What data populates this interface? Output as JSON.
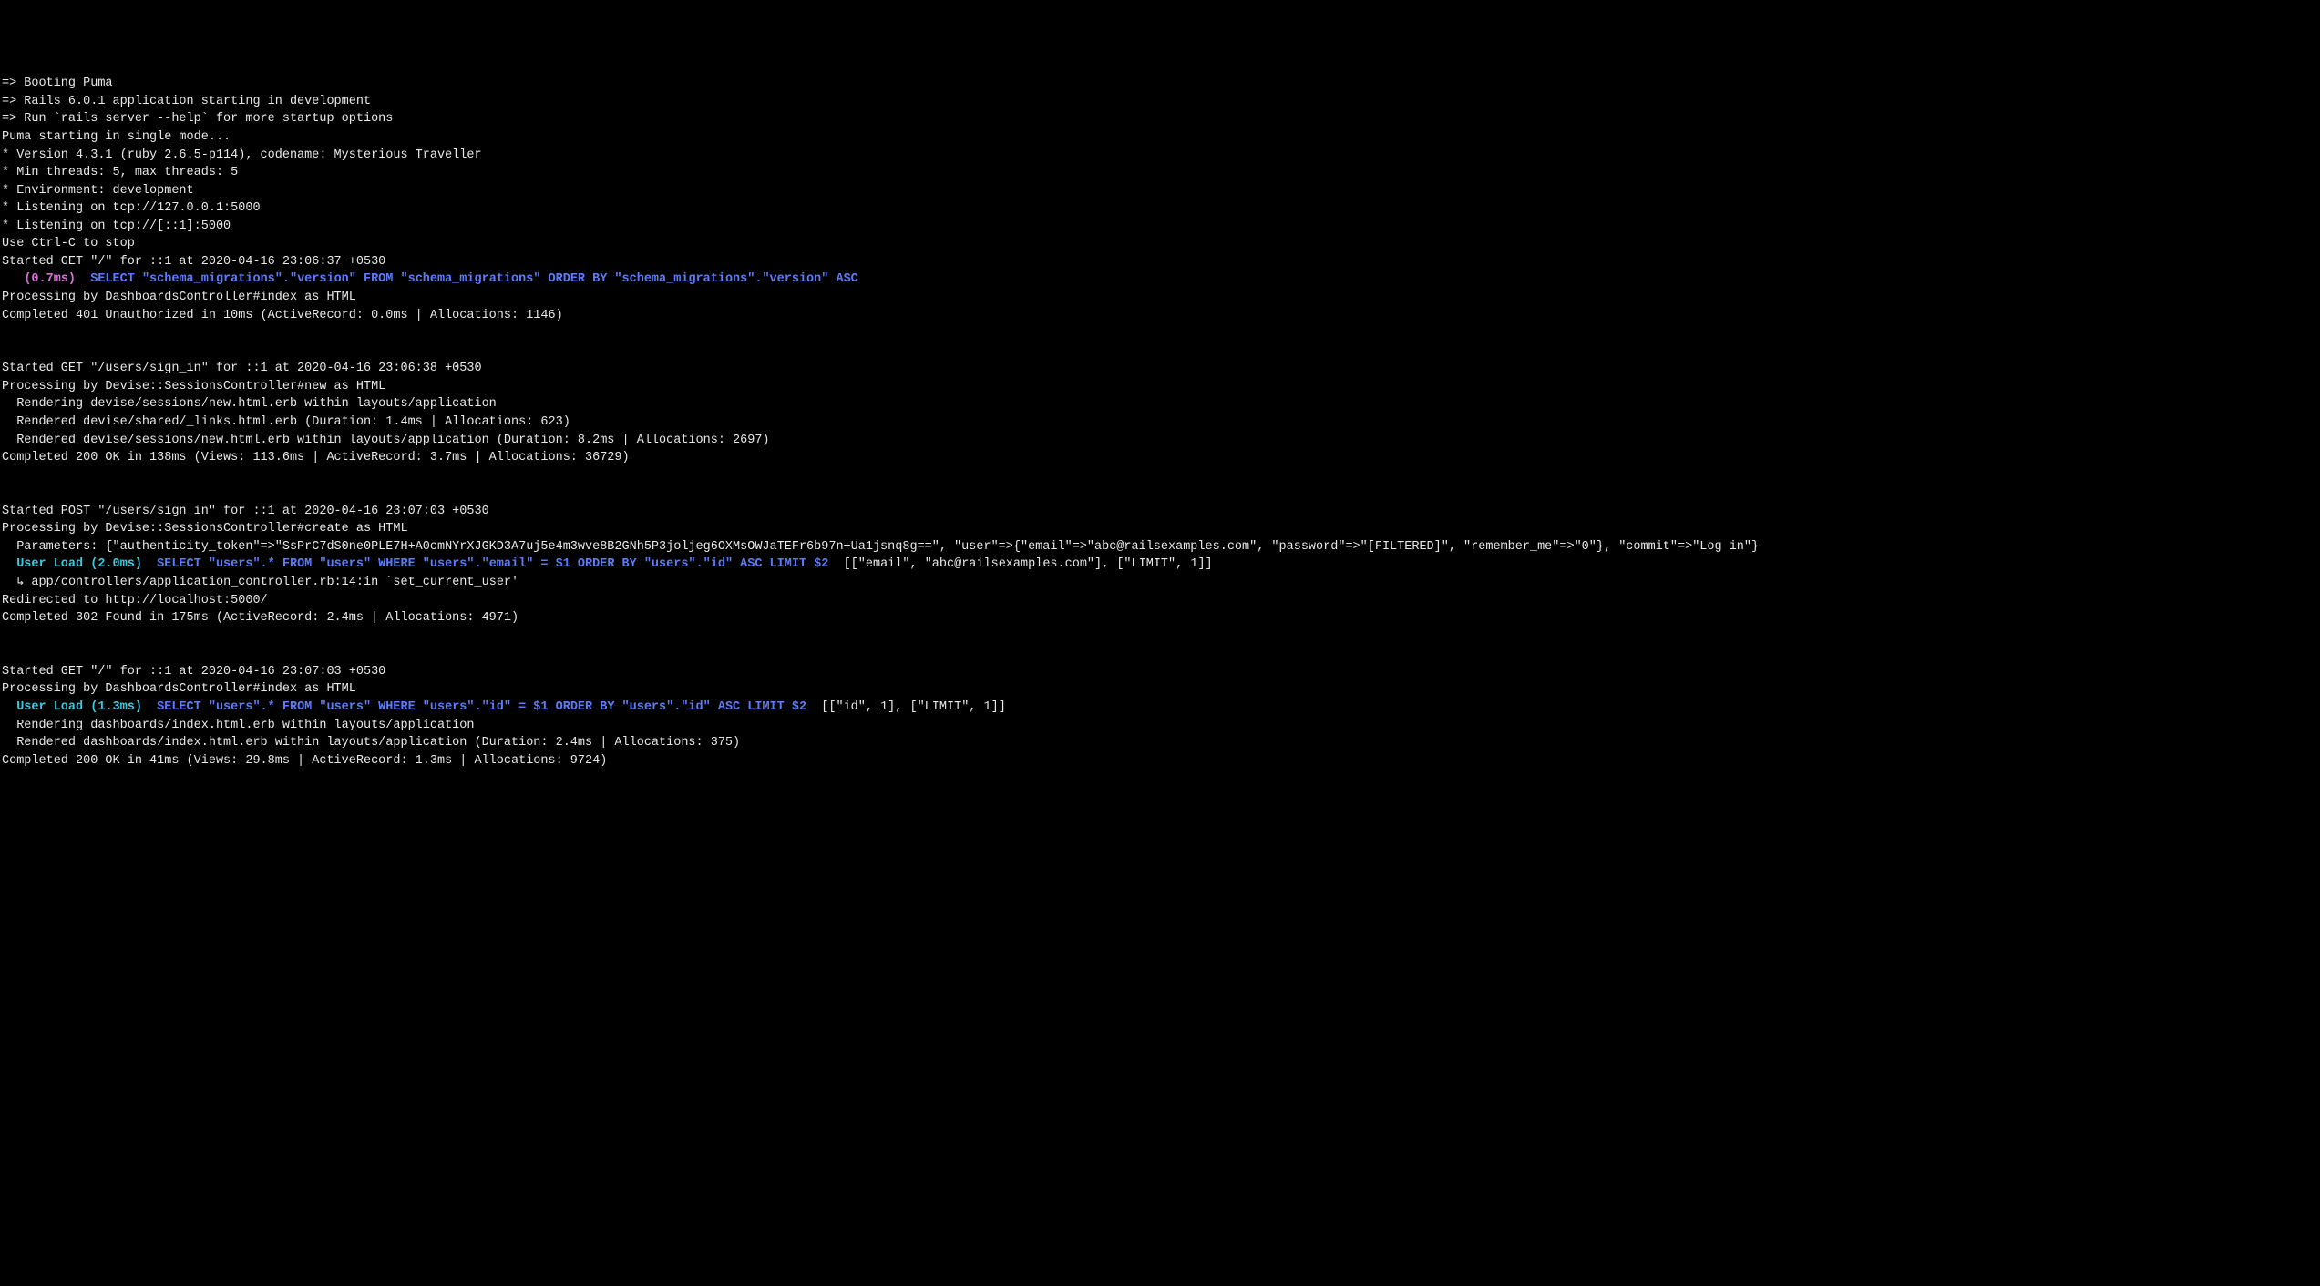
{
  "lines": [
    {
      "segments": [
        {
          "cls": "white",
          "text": "=> Booting Puma"
        }
      ]
    },
    {
      "segments": [
        {
          "cls": "white",
          "text": "=> Rails 6.0.1 application starting in development"
        }
      ]
    },
    {
      "segments": [
        {
          "cls": "white",
          "text": "=> Run `rails server --help` for more startup options"
        }
      ]
    },
    {
      "segments": [
        {
          "cls": "white",
          "text": "Puma starting in single mode..."
        }
      ]
    },
    {
      "segments": [
        {
          "cls": "white",
          "text": "* Version 4.3.1 (ruby 2.6.5-p114), codename: Mysterious Traveller"
        }
      ]
    },
    {
      "segments": [
        {
          "cls": "white",
          "text": "* Min threads: 5, max threads: 5"
        }
      ]
    },
    {
      "segments": [
        {
          "cls": "white",
          "text": "* Environment: development"
        }
      ]
    },
    {
      "segments": [
        {
          "cls": "white",
          "text": "* Listening on tcp://127.0.0.1:5000"
        }
      ]
    },
    {
      "segments": [
        {
          "cls": "white",
          "text": "* Listening on tcp://[::1]:5000"
        }
      ]
    },
    {
      "segments": [
        {
          "cls": "white",
          "text": "Use Ctrl-C to stop"
        }
      ]
    },
    {
      "segments": [
        {
          "cls": "white",
          "text": "Started GET \"/\" for ::1 at 2020-04-16 23:06:37 +0530"
        }
      ]
    },
    {
      "segments": [
        {
          "cls": "white",
          "text": "   "
        },
        {
          "cls": "magenta bold",
          "text": "(0.7ms)"
        },
        {
          "cls": "white",
          "text": "  "
        },
        {
          "cls": "blue bold",
          "text": "SELECT \"schema_migrations\".\"version\" FROM \"schema_migrations\" ORDER BY \"schema_migrations\".\"version\" ASC"
        }
      ]
    },
    {
      "segments": [
        {
          "cls": "white",
          "text": "Processing by DashboardsController#index as HTML"
        }
      ]
    },
    {
      "segments": [
        {
          "cls": "white",
          "text": "Completed 401 Unauthorized in 10ms (ActiveRecord: 0.0ms | Allocations: 1146)"
        }
      ]
    },
    {
      "segments": [
        {
          "cls": "white",
          "text": ""
        }
      ]
    },
    {
      "segments": [
        {
          "cls": "white",
          "text": ""
        }
      ]
    },
    {
      "segments": [
        {
          "cls": "white",
          "text": "Started GET \"/users/sign_in\" for ::1 at 2020-04-16 23:06:38 +0530"
        }
      ]
    },
    {
      "segments": [
        {
          "cls": "white",
          "text": "Processing by Devise::SessionsController#new as HTML"
        }
      ]
    },
    {
      "segments": [
        {
          "cls": "white",
          "text": "  Rendering devise/sessions/new.html.erb within layouts/application"
        }
      ]
    },
    {
      "segments": [
        {
          "cls": "white",
          "text": "  Rendered devise/shared/_links.html.erb (Duration: 1.4ms | Allocations: 623)"
        }
      ]
    },
    {
      "segments": [
        {
          "cls": "white",
          "text": "  Rendered devise/sessions/new.html.erb within layouts/application (Duration: 8.2ms | Allocations: 2697)"
        }
      ]
    },
    {
      "segments": [
        {
          "cls": "white",
          "text": "Completed 200 OK in 138ms (Views: 113.6ms | ActiveRecord: 3.7ms | Allocations: 36729)"
        }
      ]
    },
    {
      "segments": [
        {
          "cls": "white",
          "text": ""
        }
      ]
    },
    {
      "segments": [
        {
          "cls": "white",
          "text": ""
        }
      ]
    },
    {
      "segments": [
        {
          "cls": "white",
          "text": "Started POST \"/users/sign_in\" for ::1 at 2020-04-16 23:07:03 +0530"
        }
      ]
    },
    {
      "segments": [
        {
          "cls": "white",
          "text": "Processing by Devise::SessionsController#create as HTML"
        }
      ]
    },
    {
      "segments": [
        {
          "cls": "white",
          "text": "  Parameters: {\"authenticity_token\"=>\"SsPrC7dS0ne0PLE7H+A0cmNYrXJGKD3A7uj5e4m3wve8B2GNh5P3joljeg6OXMsOWJaTEFr6b97n+Ua1jsnq8g==\", \"user\"=>{\"email\"=>\"abc@railsexamples.com\", \"password\"=>\"[FILTERED]\", \"remember_me\"=>\"0\"}, \"commit\"=>\"Log in\"}"
        }
      ]
    },
    {
      "segments": [
        {
          "cls": "white",
          "text": "  "
        },
        {
          "cls": "cyan bold",
          "text": "User Load (2.0ms)"
        },
        {
          "cls": "white",
          "text": "  "
        },
        {
          "cls": "blue bold",
          "text": "SELECT \"users\".* FROM \"users\" WHERE \"users\".\"email\" = $1 ORDER BY \"users\".\"id\" ASC LIMIT $2"
        },
        {
          "cls": "white",
          "text": "  [[\"email\", \"abc@railsexamples.com\"], [\"LIMIT\", 1]]"
        }
      ]
    },
    {
      "segments": [
        {
          "cls": "white",
          "text": "  ↳ app/controllers/application_controller.rb:14:in `set_current_user'"
        }
      ]
    },
    {
      "segments": [
        {
          "cls": "white",
          "text": "Redirected to http://localhost:5000/"
        }
      ]
    },
    {
      "segments": [
        {
          "cls": "white",
          "text": "Completed 302 Found in 175ms (ActiveRecord: 2.4ms | Allocations: 4971)"
        }
      ]
    },
    {
      "segments": [
        {
          "cls": "white",
          "text": ""
        }
      ]
    },
    {
      "segments": [
        {
          "cls": "white",
          "text": ""
        }
      ]
    },
    {
      "segments": [
        {
          "cls": "white",
          "text": "Started GET \"/\" for ::1 at 2020-04-16 23:07:03 +0530"
        }
      ]
    },
    {
      "segments": [
        {
          "cls": "white",
          "text": "Processing by DashboardsController#index as HTML"
        }
      ]
    },
    {
      "segments": [
        {
          "cls": "white",
          "text": "  "
        },
        {
          "cls": "cyan bold",
          "text": "User Load (1.3ms)"
        },
        {
          "cls": "white",
          "text": "  "
        },
        {
          "cls": "blue bold",
          "text": "SELECT \"users\".* FROM \"users\" WHERE \"users\".\"id\" = $1 ORDER BY \"users\".\"id\" ASC LIMIT $2"
        },
        {
          "cls": "white",
          "text": "  [[\"id\", 1], [\"LIMIT\", 1]]"
        }
      ]
    },
    {
      "segments": [
        {
          "cls": "white",
          "text": "  Rendering dashboards/index.html.erb within layouts/application"
        }
      ]
    },
    {
      "segments": [
        {
          "cls": "white",
          "text": "  Rendered dashboards/index.html.erb within layouts/application (Duration: 2.4ms | Allocations: 375)"
        }
      ]
    },
    {
      "segments": [
        {
          "cls": "white",
          "text": "Completed 200 OK in 41ms (Views: 29.8ms | ActiveRecord: 1.3ms | Allocations: 9724)"
        }
      ]
    }
  ]
}
